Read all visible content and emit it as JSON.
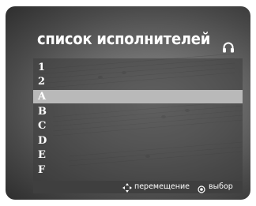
{
  "screen": {
    "title": "список исполнителей",
    "header_icon": "headphones-icon"
  },
  "list": {
    "items": [
      {
        "label": "1",
        "selected": false
      },
      {
        "label": "2",
        "selected": false
      },
      {
        "label": "A",
        "selected": true
      },
      {
        "label": "B",
        "selected": false
      },
      {
        "label": "C",
        "selected": false
      },
      {
        "label": "D",
        "selected": false
      },
      {
        "label": "E",
        "selected": false
      },
      {
        "label": "F",
        "selected": false
      }
    ]
  },
  "footer": {
    "move_icon": "navigation-arrows-icon",
    "move_label": "перемещение",
    "select_icon": "enter-circle-icon",
    "select_label": "выбор"
  },
  "colors": {
    "selected_highlight": "#b9b9b9",
    "footer_bar": "#3f3f3f",
    "text": "#ffffff"
  }
}
